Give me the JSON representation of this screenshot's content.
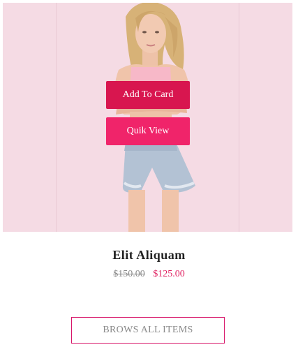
{
  "product": {
    "title": "Elit Aliquam",
    "old_price": "$150.00",
    "new_price": "$125.00",
    "image_icon": "model-photo",
    "overlay": {
      "add_to_card_label": "Add To Card",
      "quick_view_label": "Quik View"
    }
  },
  "footer": {
    "browse_label": "BROWS ALL ITEMS"
  },
  "colors": {
    "accent": "#d8164f",
    "accent_light": "#f0246a",
    "price": "#e02362",
    "image_bg": "#f5dbe4"
  }
}
